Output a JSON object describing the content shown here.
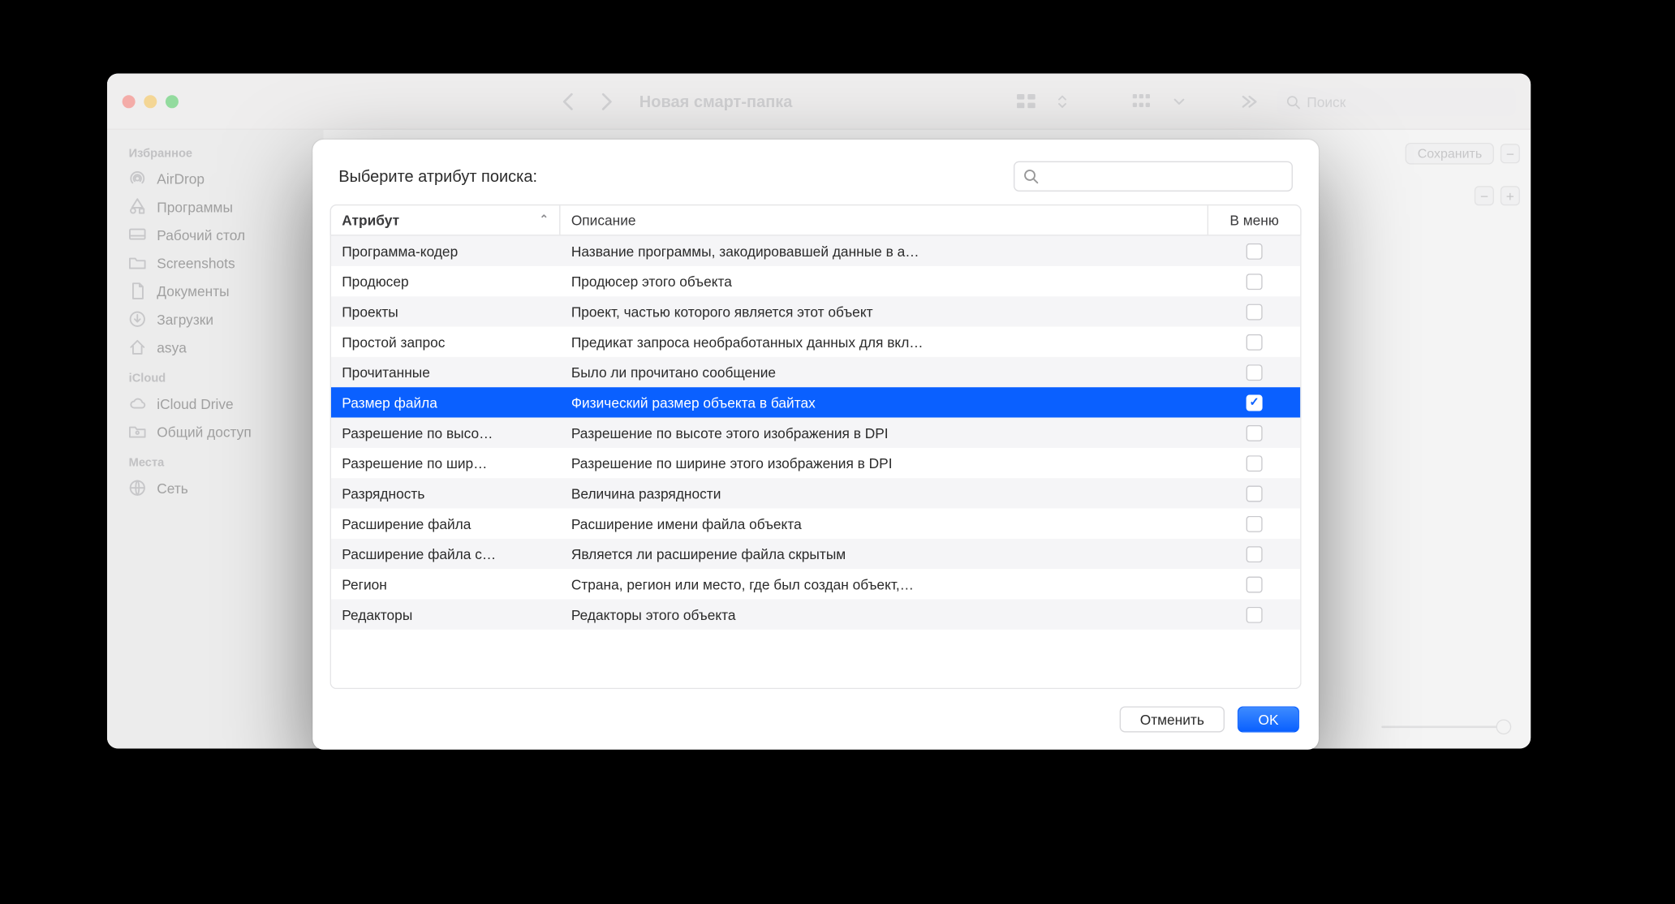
{
  "finder": {
    "title": "Новая смарт-папка",
    "search_placeholder": "Поиск",
    "save_label": "Сохранить",
    "sidebar": {
      "sections": [
        {
          "title": "Избранное",
          "items": [
            {
              "label": "AirDrop",
              "icon": "airdrop"
            },
            {
              "label": "Программы",
              "icon": "apps"
            },
            {
              "label": "Рабочий стол",
              "icon": "desktop"
            },
            {
              "label": "Screenshots",
              "icon": "folder"
            },
            {
              "label": "Документы",
              "icon": "document"
            },
            {
              "label": "Загрузки",
              "icon": "downloads"
            },
            {
              "label": "asya",
              "icon": "home"
            }
          ]
        },
        {
          "title": "iCloud",
          "items": [
            {
              "label": "iCloud Drive",
              "icon": "cloud"
            },
            {
              "label": "Общий доступ",
              "icon": "shared-folder"
            }
          ]
        },
        {
          "title": "Места",
          "items": [
            {
              "label": "Сеть",
              "icon": "network"
            }
          ]
        }
      ]
    }
  },
  "sheet": {
    "prompt": "Выберите атрибут поиска:",
    "columns": {
      "attr": "Атрибут",
      "desc": "Описание",
      "menu": "В меню"
    },
    "rows": [
      {
        "attr": "Программа-кодер",
        "desc": "Название программы, закодировавшей данные в а…",
        "checked": false,
        "selected": false
      },
      {
        "attr": "Продюсер",
        "desc": "Продюсер этого объекта",
        "checked": false,
        "selected": false
      },
      {
        "attr": "Проекты",
        "desc": "Проект, частью которого является этот объект",
        "checked": false,
        "selected": false
      },
      {
        "attr": "Простой запрос",
        "desc": "Предикат запроса необработанных данных для вкл…",
        "checked": false,
        "selected": false
      },
      {
        "attr": "Прочитанные",
        "desc": "Было ли прочитано сообщение",
        "checked": false,
        "selected": false
      },
      {
        "attr": "Размер файла",
        "desc": "Физический размер объекта в байтах",
        "checked": true,
        "selected": true
      },
      {
        "attr": "Разрешение по высо…",
        "desc": "Разрешение по высоте этого изображения в DPI",
        "checked": false,
        "selected": false
      },
      {
        "attr": "Разрешение по шир…",
        "desc": "Разрешение по ширине этого изображения в DPI",
        "checked": false,
        "selected": false
      },
      {
        "attr": "Разрядность",
        "desc": "Величина разрядности",
        "checked": false,
        "selected": false
      },
      {
        "attr": "Расширение файла",
        "desc": "Расширение имени файла объекта",
        "checked": false,
        "selected": false
      },
      {
        "attr": "Расширение файла с…",
        "desc": "Является ли расширение файла скрытым",
        "checked": false,
        "selected": false
      },
      {
        "attr": "Регион",
        "desc": "Страна, регион или место, где был создан объект,…",
        "checked": false,
        "selected": false
      },
      {
        "attr": "Редакторы",
        "desc": "Редакторы этого объекта",
        "checked": false,
        "selected": false
      }
    ],
    "cancel": "Отменить",
    "ok": "OK"
  }
}
